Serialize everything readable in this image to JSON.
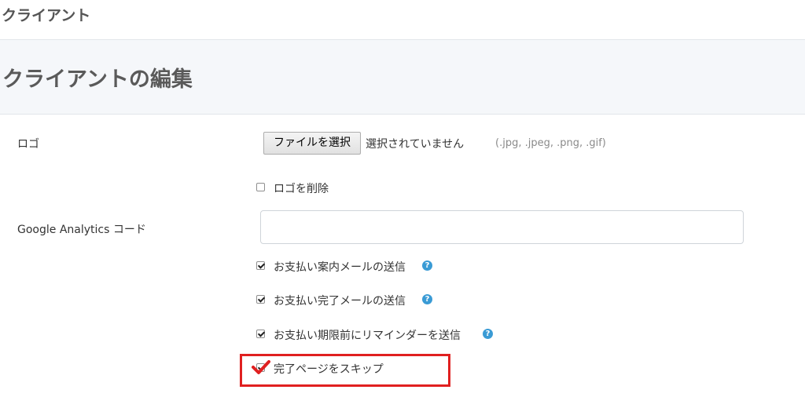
{
  "topbar": {
    "title": "クライアント"
  },
  "page": {
    "title": "クライアントの編集"
  },
  "form": {
    "logo": {
      "label": "ロゴ",
      "file_button": "ファイルを選択",
      "file_status": "選択されていません",
      "file_hint": "(.jpg, .jpeg, .png, .gif)",
      "delete_label": "ロゴを削除",
      "delete_checked": false
    },
    "analytics": {
      "label": "Google Analytics コード",
      "value": "",
      "placeholder": ""
    },
    "options": [
      {
        "label": "お支払い案内メールの送信",
        "checked": true,
        "help": true
      },
      {
        "label": "お支払い完了メールの送信",
        "checked": true,
        "help": true
      },
      {
        "label": "お支払い期限前にリマインダーを送信",
        "checked": true,
        "help": true
      },
      {
        "label": "完了ページをスキップ",
        "checked": true,
        "help": false
      }
    ]
  },
  "icons": {
    "help": "question-circle-icon",
    "annotation_check": "red-checkmark-icon"
  },
  "colors": {
    "help_icon": "#3a9bd5",
    "highlight": "#e02020",
    "header_bg": "#f5f7fa"
  }
}
